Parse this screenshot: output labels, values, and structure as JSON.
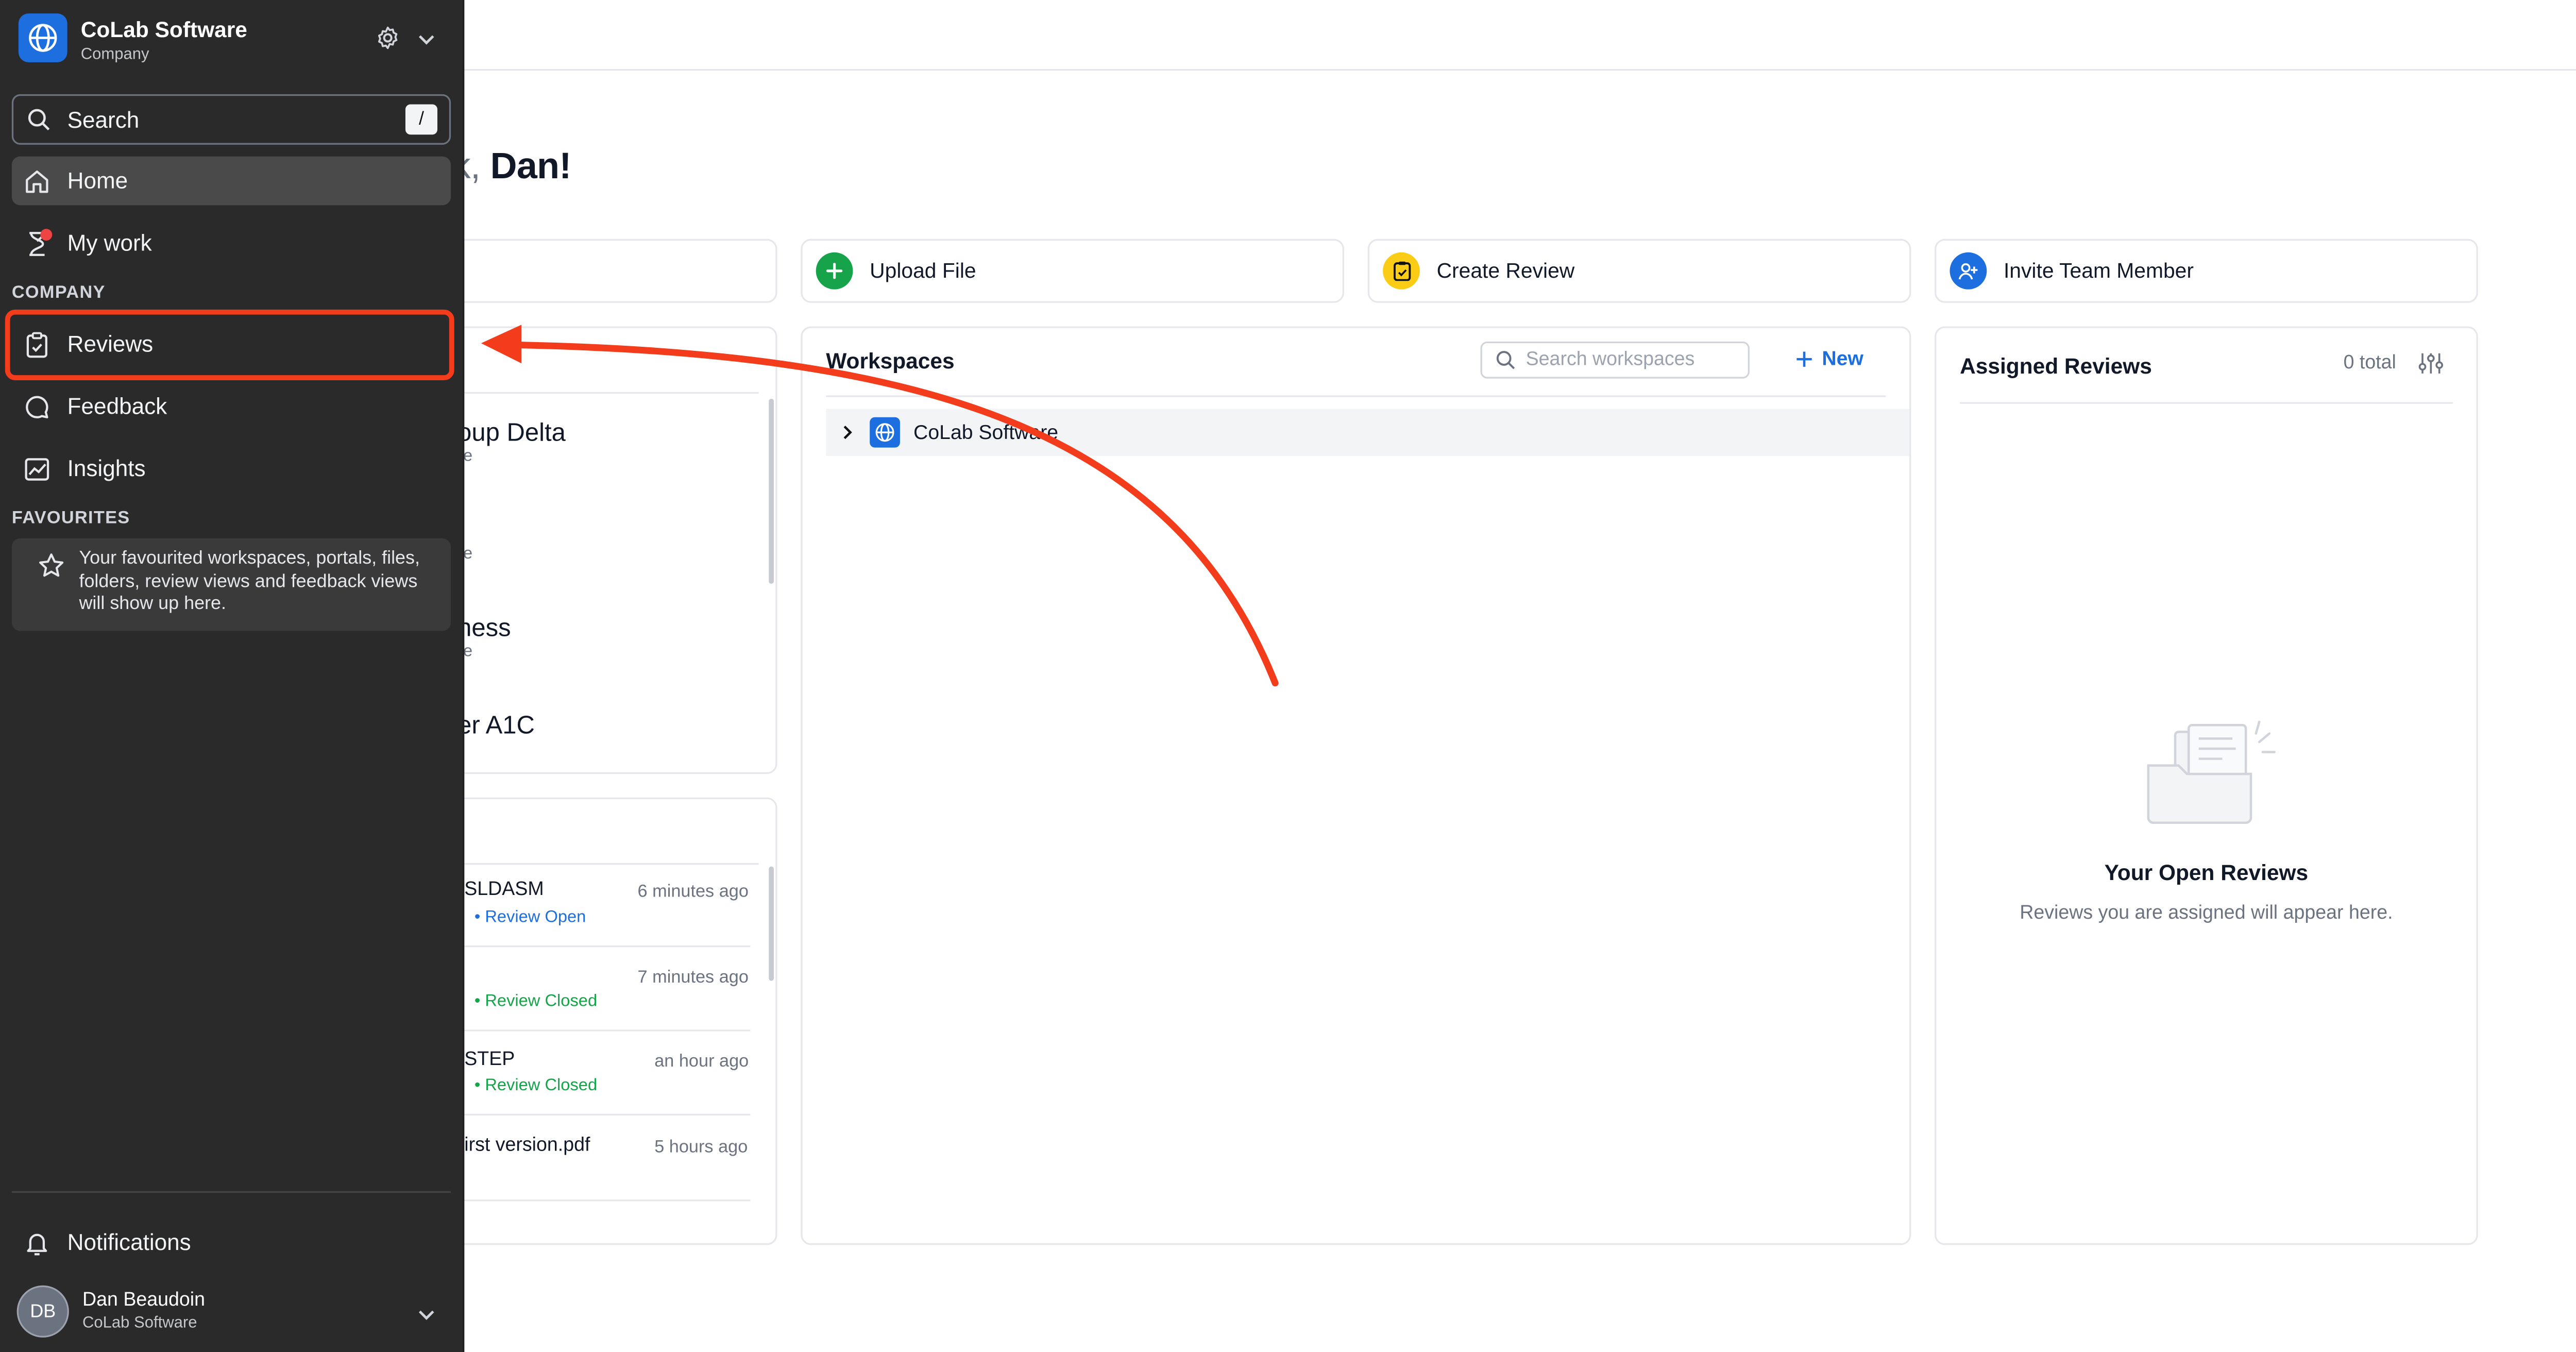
{
  "greeting": {
    "prefix": "ck,",
    "name": "Dan!"
  },
  "quick_actions": [
    {
      "label": "Upload File",
      "icon": "plus-icon",
      "color": "#16a34a"
    },
    {
      "label": "Create Review",
      "icon": "clipboard-icon",
      "color": "#facc15"
    },
    {
      "label": "Invite Team Member",
      "icon": "user-plus-icon",
      "color": "#1d6fe0"
    }
  ],
  "workspaces": {
    "title": "Workspaces",
    "search_placeholder": "Search workspaces",
    "new_label": "New",
    "rows": [
      {
        "name": "CoLab Software"
      }
    ]
  },
  "assigned_reviews": {
    "title": "Assigned Reviews",
    "total": "0 total",
    "empty_title": "Your Open Reviews",
    "empty_subtitle": "Reviews you are assigned will appear here."
  },
  "recent_files_fragments": [
    {
      "name": "oup Delta",
      "sub": "re"
    },
    {
      "name": "",
      "sub": "re"
    },
    {
      "name": "ness",
      "sub": "re"
    },
    {
      "name": "er A1C",
      "sub": "re"
    }
  ],
  "activity_fragments": [
    {
      "name": "SLDASM",
      "time": "6 minutes ago",
      "status": "Review Open",
      "status_color": "#1d6fe0"
    },
    {
      "name": "",
      "time": "7 minutes ago",
      "status": "Review Closed",
      "status_color": "#16a34a"
    },
    {
      "name": "STEP",
      "time": "an hour ago",
      "status": "Review Closed",
      "status_color": "#16a34a"
    },
    {
      "name": "irst version.pdf",
      "time": "5 hours ago",
      "status": "",
      "status_color": "#16a34a"
    }
  ],
  "sidebar": {
    "org_name": "CoLab Software",
    "org_type": "Company",
    "search_label": "Search",
    "search_shortcut": "/",
    "nav_top": [
      {
        "label": "Home",
        "icon": "home-icon",
        "active": true
      },
      {
        "label": "My work",
        "icon": "hourglass-icon",
        "active": false
      }
    ],
    "company_section": "COMPANY",
    "company_items": [
      {
        "label": "Reviews",
        "icon": "clipboard-check-icon"
      },
      {
        "label": "Feedback",
        "icon": "chat-bubble-icon"
      },
      {
        "label": "Insights",
        "icon": "chart-icon"
      }
    ],
    "favourites_section": "FAVOURITES",
    "favourites_empty": "Your favourited workspaces, portals, files, folders, review views and feedback views will show up here.",
    "notifications_label": "Notifications",
    "user_initials": "DB",
    "user_name": "Dan Beaudoin",
    "user_org": "CoLab Software"
  },
  "colors": {
    "accent": "#1d6fe0",
    "highlight": "#f23c1b",
    "sidebar_bg": "#2a2a2a"
  }
}
